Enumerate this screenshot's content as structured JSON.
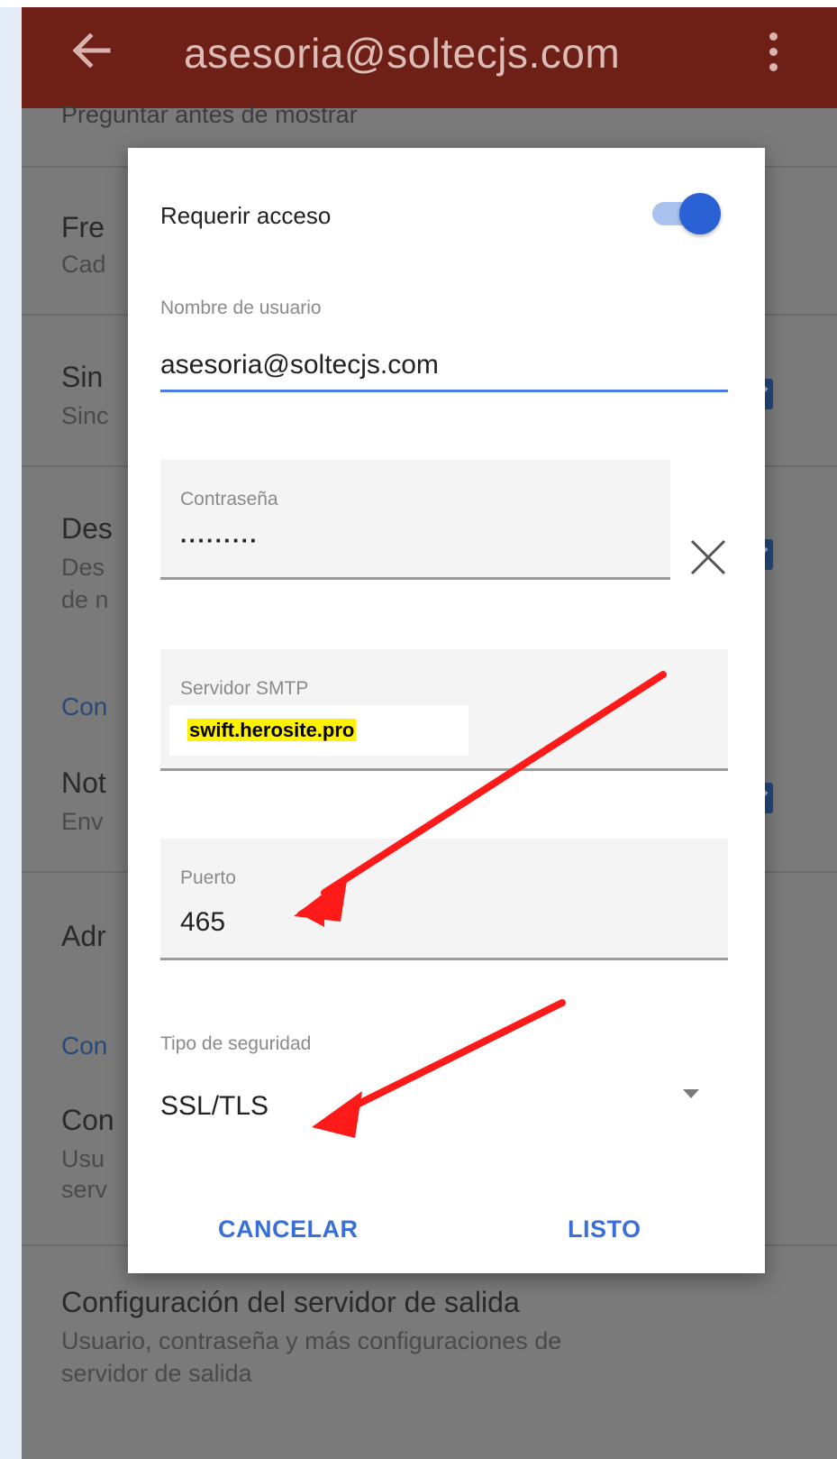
{
  "appbar": {
    "title": "asesoria@soltecjs.com",
    "background_color": "#6e1f16"
  },
  "background": {
    "partial_top_text": "Preguntar antes de mostrar",
    "items": [
      {
        "title": "Fre",
        "subtitle": "Cad"
      },
      {
        "title": "Sin",
        "subtitle": "Sinc"
      },
      {
        "title": "Des",
        "subtitle": "Des",
        "subtitle2": "de n"
      },
      {
        "section": "Con"
      },
      {
        "title": "Not",
        "subtitle": "Env"
      },
      {
        "title": "Adr"
      },
      {
        "section": "Con"
      },
      {
        "title": "Con",
        "subtitle": "Usu",
        "subtitle2": "serv"
      }
    ],
    "bottom_item": {
      "title": "Configuración del servidor de salida",
      "subtitle": "Usuario, contraseña y más configuraciones de",
      "subtitle2": "servidor de salida"
    }
  },
  "dialog": {
    "require_access_label": "Requerir acceso",
    "require_access_on": true,
    "username": {
      "label": "Nombre de usuario",
      "value": "asesoria@soltecjs.com"
    },
    "password": {
      "label": "Contraseña",
      "value": "·········"
    },
    "smtp": {
      "label": "Servidor SMTP",
      "value": "swift.herosite.pro"
    },
    "port": {
      "label": "Puerto",
      "value": "465"
    },
    "security": {
      "label": "Tipo de seguridad",
      "value": "SSL/TLS"
    },
    "cancel_label": "CANCELAR",
    "done_label": "LISTO",
    "accent_color": "#3a6fd8",
    "toggle_color": "#2a62d6",
    "highlight_color": "#fff200",
    "annotation_arrow_color": "#ff1a1a"
  }
}
